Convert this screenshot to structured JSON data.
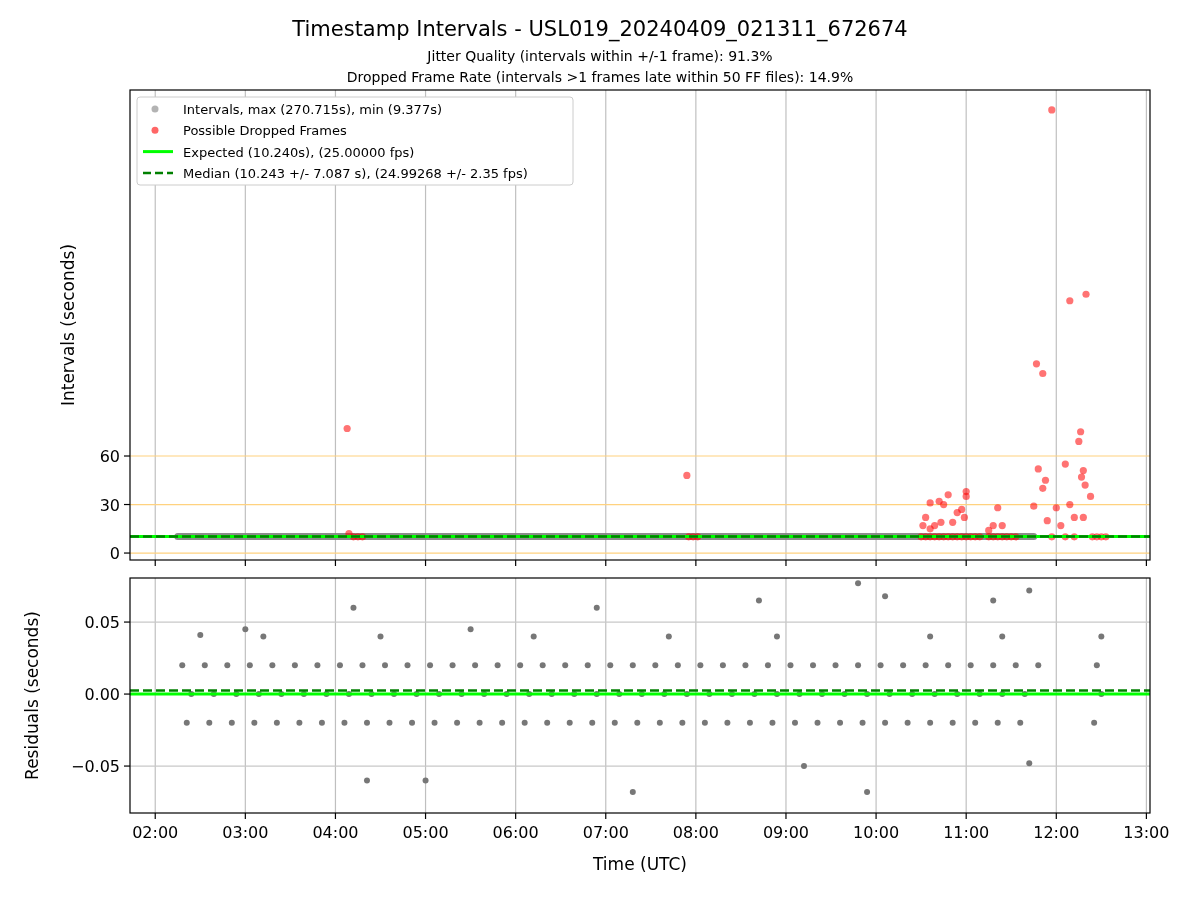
{
  "title": "Timestamp Intervals - USL019_20240409_021311_672674",
  "subtitles": [
    "Jitter Quality (intervals within +/-1 frame): 91.3%",
    "Dropped Frame Rate (intervals >1 frames late within 50 FF files): 14.9%"
  ],
  "intervals_chart": {
    "chart_data": {
      "type": "scatter",
      "grid": true,
      "legend": true,
      "ylabel": "Intervals (seconds)",
      "xlim": [
        1.72,
        13.04
      ],
      "ylim": [
        -4.3,
        286.3
      ],
      "yticks": [
        {
          "value": 0,
          "label": "0"
        },
        {
          "value": 30,
          "label": "30"
        },
        {
          "value": 60,
          "label": "60"
        }
      ],
      "series": [
        {
          "name": "Intervals, max (270.715s), min (9.377s)",
          "type": "line",
          "color": "#808080",
          "x": [
            2.25,
            11.75
          ],
          "values": [
            10.2,
            10.2
          ]
        },
        {
          "name": "Possible Dropped Frames",
          "type": "scatter",
          "color": "#ff0000",
          "x": [
            4.13,
            4.15,
            4.2,
            4.25,
            4.3,
            7.9,
            7.92,
            7.97,
            8.02,
            10.5,
            10.55,
            10.6,
            10.65,
            10.7,
            10.75,
            10.8,
            10.85,
            10.9,
            10.95,
            11.0,
            11.05,
            11.1,
            11.15,
            11.25,
            11.3,
            11.35,
            11.4,
            11.45,
            11.5,
            11.55,
            10.55,
            10.6,
            10.6,
            10.65,
            10.7,
            10.75,
            10.8,
            10.9,
            10.95,
            11.0,
            11.0,
            10.98,
            11.35,
            11.3,
            11.4,
            11.25,
            10.52,
            10.72,
            10.85,
            11.78,
            11.85,
            11.95,
            12.15,
            12.33,
            12.25,
            12.27,
            11.8,
            11.85,
            11.88,
            12.1,
            12.3,
            12.28,
            12.32,
            12.38,
            12.0,
            12.15,
            12.2,
            12.3,
            11.75,
            11.9,
            12.05,
            11.95,
            12.1,
            12.2,
            12.45,
            12.5,
            12.55,
            12.4
          ],
          "values": [
            77,
            12,
            10,
            10,
            10,
            48,
            10,
            10,
            10,
            10,
            10,
            10,
            10,
            10,
            10,
            10,
            10,
            10,
            10,
            10,
            10,
            10,
            10,
            10,
            10,
            10,
            10,
            10,
            10,
            10,
            22,
            31,
            15,
            17,
            32,
            30,
            36,
            25,
            27,
            38,
            35,
            22,
            28,
            17,
            17,
            14,
            17,
            19,
            19,
            117,
            111,
            274,
            156,
            160,
            69,
            75,
            52,
            40,
            45,
            55,
            51,
            47,
            42,
            35,
            28,
            30,
            22,
            22,
            29,
            20,
            17,
            10,
            10,
            10,
            10,
            10,
            10,
            10
          ]
        },
        {
          "name": "Expected (10.240s), (25.00000 fps)",
          "type": "line",
          "color": "#00ff00",
          "x": [
            1.72,
            13.04
          ],
          "values": [
            10.2,
            10.2
          ]
        },
        {
          "name": "Median (10.243 +/- 7.087 s), (24.99268 +/- 2.35 fps)",
          "type": "line",
          "line_style": "dashed",
          "color": "#008000",
          "x": [
            1.72,
            13.04
          ],
          "values": [
            10.2,
            10.2
          ]
        }
      ]
    }
  },
  "residuals_chart": {
    "chart_data": {
      "type": "scatter",
      "grid": true,
      "xlabel": "Time (UTC)",
      "ylabel": "Residuals (seconds)",
      "xlim": [
        1.72,
        13.04
      ],
      "ylim": [
        -0.0826,
        0.0806
      ],
      "xticks": [
        {
          "value": 2,
          "label": "02:00"
        },
        {
          "value": 3,
          "label": "03:00"
        },
        {
          "value": 4,
          "label": "04:00"
        },
        {
          "value": 5,
          "label": "05:00"
        },
        {
          "value": 6,
          "label": "06:00"
        },
        {
          "value": 7,
          "label": "07:00"
        },
        {
          "value": 8,
          "label": "08:00"
        },
        {
          "value": 9,
          "label": "09:00"
        },
        {
          "value": 10,
          "label": "10:00"
        },
        {
          "value": 11,
          "label": "11:00"
        },
        {
          "value": 12,
          "label": "12:00"
        },
        {
          "value": 13,
          "label": "13:00"
        }
      ],
      "yticks": [
        {
          "value": -0.05,
          "label": "−0.05"
        },
        {
          "value": 0,
          "label": "0.00"
        },
        {
          "value": 0.05,
          "label": "0.05"
        }
      ],
      "series": [
        {
          "type": "scatter",
          "color": "#777777",
          "x": [
            2.3,
            2.55,
            2.8,
            3.05,
            3.3,
            3.55,
            3.8,
            4.05,
            4.3,
            4.55,
            4.8,
            5.05,
            5.3,
            5.55,
            5.8,
            6.05,
            6.3,
            6.55,
            6.8,
            7.05,
            7.3,
            7.55,
            7.8,
            8.05,
            8.3,
            8.55,
            8.8,
            9.05,
            9.3,
            9.55,
            9.8,
            10.05,
            10.3,
            10.55,
            10.8,
            11.05,
            11.3,
            11.55,
            11.8,
            12.45,
            2.4,
            2.65,
            2.9,
            3.15,
            3.4,
            3.65,
            3.9,
            4.15,
            4.4,
            4.65,
            4.9,
            5.15,
            5.4,
            5.65,
            5.9,
            6.15,
            6.4,
            6.65,
            6.9,
            7.15,
            7.4,
            7.65,
            7.9,
            8.15,
            8.4,
            8.65,
            8.9,
            9.15,
            9.4,
            9.65,
            9.9,
            10.15,
            10.4,
            10.65,
            10.9,
            11.15,
            11.4,
            11.65,
            12.5,
            2.35,
            2.6,
            2.85,
            3.1,
            3.35,
            3.6,
            3.85,
            4.1,
            4.35,
            4.6,
            4.85,
            5.1,
            5.35,
            5.6,
            5.85,
            6.1,
            6.35,
            6.6,
            6.85,
            7.1,
            7.35,
            7.6,
            7.85,
            8.1,
            8.35,
            8.6,
            8.85,
            9.1,
            9.35,
            9.6,
            9.85,
            10.1,
            10.35,
            10.6,
            10.85,
            11.1,
            11.35,
            11.6,
            12.42,
            4.2,
            4.35,
            5.0,
            7.3,
            8.7,
            9.8,
            9.9,
            10.1,
            11.3,
            11.7,
            11.7,
            6.9,
            3.0,
            5.5,
            9.2,
            2.5,
            3.2,
            4.5,
            6.2,
            7.7,
            8.9,
            10.6,
            11.4,
            12.5
          ],
          "values": [
            0.02,
            0.02,
            0.02,
            0.02,
            0.02,
            0.02,
            0.02,
            0.02,
            0.02,
            0.02,
            0.02,
            0.02,
            0.02,
            0.02,
            0.02,
            0.02,
            0.02,
            0.02,
            0.02,
            0.02,
            0.02,
            0.02,
            0.02,
            0.02,
            0.02,
            0.02,
            0.02,
            0.02,
            0.02,
            0.02,
            0.02,
            0.02,
            0.02,
            0.02,
            0.02,
            0.02,
            0.02,
            0.02,
            0.02,
            0.02,
            0.0,
            0.0,
            0.0,
            0.0,
            0.0,
            0.0,
            0.0,
            0.0,
            0.0,
            0.0,
            0.0,
            0.0,
            0.0,
            0.0,
            0.0,
            0.0,
            0.0,
            0.0,
            0.0,
            0.0,
            0.0,
            0.0,
            0.0,
            0.0,
            0.0,
            0.0,
            0.0,
            0.0,
            0.0,
            0.0,
            0.0,
            0.0,
            0.0,
            0.0,
            0.0,
            0.0,
            0.0,
            0.0,
            0.0,
            -0.02,
            -0.02,
            -0.02,
            -0.02,
            -0.02,
            -0.02,
            -0.02,
            -0.02,
            -0.02,
            -0.02,
            -0.02,
            -0.02,
            -0.02,
            -0.02,
            -0.02,
            -0.02,
            -0.02,
            -0.02,
            -0.02,
            -0.02,
            -0.02,
            -0.02,
            -0.02,
            -0.02,
            -0.02,
            -0.02,
            -0.02,
            -0.02,
            -0.02,
            -0.02,
            -0.02,
            -0.02,
            -0.02,
            -0.02,
            -0.02,
            -0.02,
            -0.02,
            -0.02,
            -0.02,
            0.06,
            -0.06,
            -0.06,
            -0.068,
            0.065,
            0.077,
            -0.068,
            0.068,
            0.065,
            0.072,
            -0.048,
            0.06,
            0.045,
            0.045,
            -0.05,
            0.041,
            0.04,
            0.04,
            0.04,
            0.04,
            0.04,
            0.04,
            0.04,
            0.04
          ]
        },
        {
          "type": "line",
          "color": "#00ff00",
          "x": [
            1.72,
            13.04
          ],
          "values": [
            0,
            0
          ]
        },
        {
          "type": "line",
          "line_style": "dashed",
          "color": "#008000",
          "x": [
            1.72,
            13.04
          ],
          "values": [
            0.0025,
            0.0025
          ]
        }
      ]
    }
  }
}
